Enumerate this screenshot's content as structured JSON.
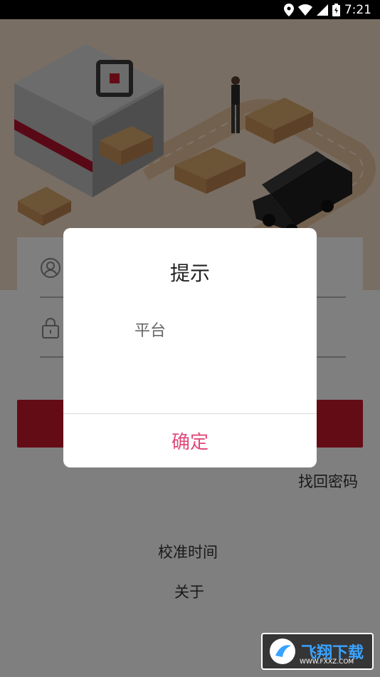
{
  "status_bar": {
    "time": "7:21"
  },
  "login": {
    "forgot_password": "找回密码",
    "calibrate_time": "校准时间",
    "about": "关于"
  },
  "dialog": {
    "title": "提示",
    "message": "平台",
    "confirm_label": "确定"
  },
  "watermark": {
    "brand": "飞翔下载",
    "url": "WWW.FXXZ.COM"
  },
  "colors": {
    "accent": "#c8182c",
    "dialog_button": "#e24a7b",
    "hero_bg": "#f2dcc8"
  }
}
